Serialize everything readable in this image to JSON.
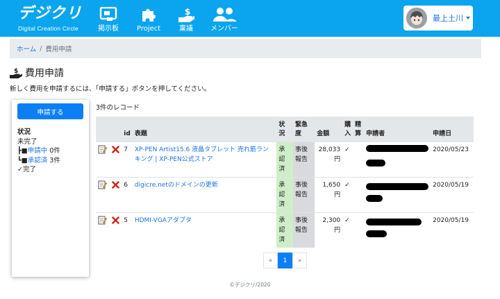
{
  "brand": {
    "logo": "デジクリ",
    "subtitle": "Digital Creation Circle"
  },
  "nav": [
    {
      "label": "掲示板",
      "icon": "bulletin-board-icon"
    },
    {
      "label": "Project",
      "icon": "puzzle-icon"
    },
    {
      "label": "稟議",
      "icon": "money-hand-icon"
    },
    {
      "label": "メンバー",
      "icon": "members-icon"
    }
  ],
  "user": {
    "name": "最上土川"
  },
  "breadcrumb": {
    "home": "ホーム",
    "separator": "/",
    "current": "費用申請"
  },
  "page": {
    "title": "費用申請",
    "description": "新しく費用を申請するには、「申請する」ボタンを押してください。"
  },
  "sidebar": {
    "apply_button": "申請する",
    "status_heading": "状況",
    "incomplete": "未完了",
    "pending_prefix": "┣■",
    "pending_link": "申請中",
    "pending_count": "0件",
    "approved_prefix": "┗■",
    "approved_link": "承認済",
    "approved_count": "3件",
    "completed": "✓完了"
  },
  "record_count": "3件のレコード",
  "table": {
    "headers": {
      "id": "id",
      "title": "表題",
      "status": "状況",
      "urgency": "緊急度",
      "amount": "金額",
      "purchased": "購入",
      "settled": "精算",
      "applicant": "申請者",
      "date": "申請日"
    },
    "rows": [
      {
        "id": "7",
        "title": "XP-PEN Artist15.6 液晶タブレット 売れ筋ランキング | XP-PEN公式ストア",
        "status": "承認済",
        "urgency": "事後報告",
        "amount": "28,033円",
        "purchased": "✓",
        "settled": "",
        "date": "2020/05/23"
      },
      {
        "id": "6",
        "title": "digicre.netのドメインの更新",
        "status": "承認済",
        "urgency": "事後報告",
        "amount": "1,650円",
        "purchased": "✓",
        "settled": "",
        "date": "2020/05/19"
      },
      {
        "id": "5",
        "title": "HDMI-VGAアダプタ",
        "status": "承認済",
        "urgency": "事後報告",
        "amount": "2,300円",
        "purchased": "✓",
        "settled": "",
        "date": "2020/05/19"
      }
    ]
  },
  "pagination": {
    "prev": "«",
    "current": "1",
    "next": "»"
  },
  "footer": "©デジクリ/2020",
  "colors": {
    "navbar": "#0aa5ee",
    "primary": "#0d7ff5",
    "approved_bg": "#cfeec8",
    "link": "#1a73e8"
  }
}
